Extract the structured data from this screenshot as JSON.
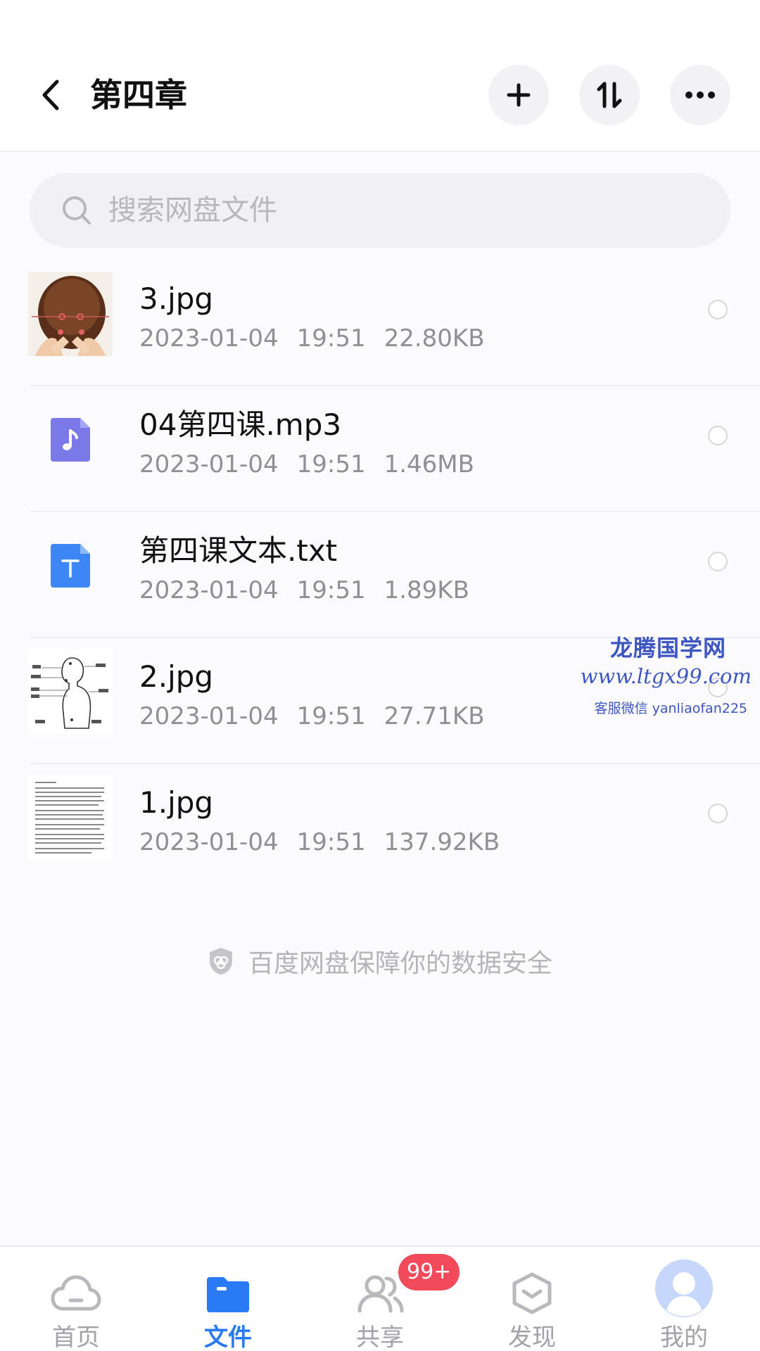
{
  "header": {
    "title": "第四章",
    "back_icon": "chevron-left-icon",
    "actions": [
      {
        "icon": "plus-icon",
        "label": "add"
      },
      {
        "icon": "sort-icon",
        "label": "sort"
      },
      {
        "icon": "more-icon",
        "label": "more"
      }
    ]
  },
  "search": {
    "placeholder": "搜索网盘文件",
    "value": ""
  },
  "files": [
    {
      "name": "3.jpg",
      "date": "2023-01-04",
      "time": "19:51",
      "size": "22.80KB",
      "type": "image",
      "thumb": "head-photo"
    },
    {
      "name": "04第四课.mp3",
      "date": "2023-01-04",
      "time": "19:51",
      "size": "1.46MB",
      "type": "audio",
      "thumb": "music-file-icon"
    },
    {
      "name": "第四课文本.txt",
      "date": "2023-01-04",
      "time": "19:51",
      "size": "1.89KB",
      "type": "text",
      "thumb": "text-file-icon"
    },
    {
      "name": "2.jpg",
      "date": "2023-01-04",
      "time": "19:51",
      "size": "27.71KB",
      "type": "image",
      "thumb": "body-diagram"
    },
    {
      "name": "1.jpg",
      "date": "2023-01-04",
      "time": "19:51",
      "size": "137.92KB",
      "type": "image",
      "thumb": "text-page"
    }
  ],
  "watermark": {
    "title": "龙腾国学网",
    "url": "www.ltgx99.com",
    "wechat": "客服微信 yanliaofan225"
  },
  "security_note": "百度网盘保障你的数据安全",
  "tabbar": {
    "tabs": [
      {
        "label": "首页",
        "icon": "cloud-icon",
        "active": false
      },
      {
        "label": "文件",
        "icon": "folder-icon",
        "active": true
      },
      {
        "label": "共享",
        "icon": "people-icon",
        "active": false
      },
      {
        "label": "发现",
        "icon": "discover-icon",
        "active": false
      },
      {
        "label": "我的",
        "icon": "avatar-icon",
        "active": false
      }
    ],
    "share_badge": "99+"
  },
  "colors": {
    "accent": "#2a7af5",
    "badge": "#f24a5a",
    "audio_icon": "#7b78e8",
    "text_icon": "#3d86f5",
    "watermark": "#3d56c2"
  }
}
